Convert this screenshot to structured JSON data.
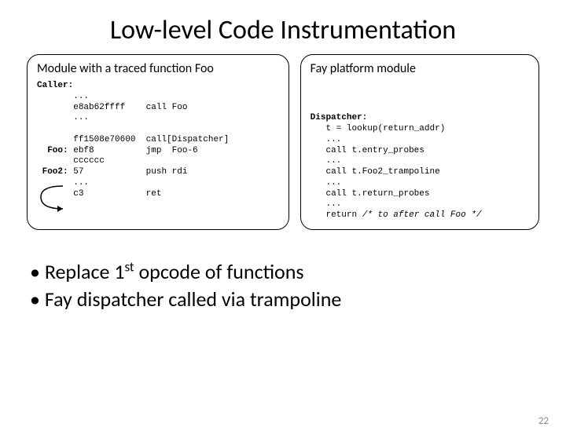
{
  "title": "Low-level Code Instrumentation",
  "left_panel_title": "Module with a traced function Foo",
  "right_panel_title": "Fay platform module",
  "caller_label": "Caller:",
  "caller_line1": "...",
  "caller_line2_hex": "e8ab62ffff",
  "caller_line2_instr": "call Foo",
  "caller_line3": "...",
  "foo_label": "Foo:",
  "foo_line1_hex": "ff1508e70600",
  "foo_line1_instr": "call[Dispatcher]",
  "foo_line2_hex": "ebf8",
  "foo_line2_instr": "jmp  Foo-6",
  "foo_line3_hex": "cccccc",
  "foo2_label": "Foo2:",
  "foo2_line1_hex": "57",
  "foo2_line1_instr": "push rdi",
  "foo2_line2": "...",
  "foo2_line3_hex": "c3",
  "foo2_line3_instr": "ret",
  "dispatcher_label": "Dispatcher:",
  "disp_line1": "t = lookup(return_addr)",
  "disp_line2": "...",
  "disp_line3": "call t.entry_probes",
  "disp_line4": "...",
  "disp_line5": "call t.Foo2_trampoline",
  "disp_line6": "...",
  "disp_line7": "call t.return_probes",
  "disp_line8": "...",
  "disp_line9a": "return",
  "disp_line9b": "/* to after call Foo */",
  "bullet1_a": "• Replace 1",
  "bullet1_sup": "st",
  "bullet1_b": " opcode of functions",
  "bullet2": "• Fay dispatcher called via trampoline",
  "page_number": "22"
}
